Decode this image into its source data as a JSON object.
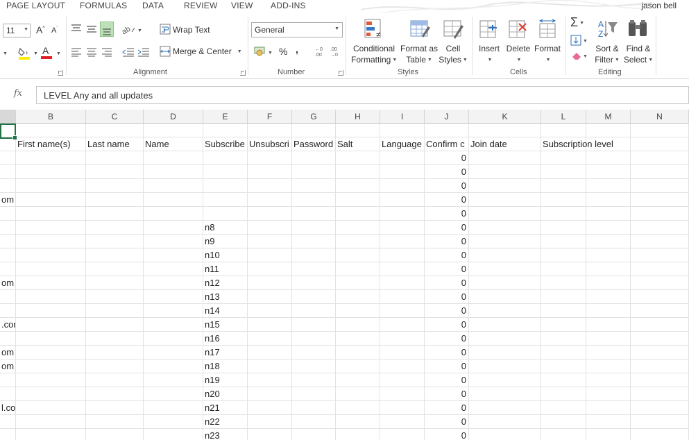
{
  "tabs": [
    "PAGE LAYOUT",
    "FORMULAS",
    "DATA",
    "REVIEW",
    "VIEW",
    "ADD-INS"
  ],
  "user": "jason bell",
  "ribbon": {
    "font_size": "11",
    "wrap_text": "Wrap Text",
    "merge_center": "Merge & Center",
    "number_format": "General",
    "percent": "%",
    "comma": ",",
    "conditional_formatting": [
      "Conditional",
      "Formatting"
    ],
    "format_as_table": [
      "Format as",
      "Table"
    ],
    "cell_styles": [
      "Cell",
      "Styles"
    ],
    "insert": "Insert",
    "delete": "Delete",
    "format": "Format",
    "sort_filter": [
      "Sort &",
      "Filter"
    ],
    "find_select": [
      "Find &",
      "Select"
    ],
    "groups": {
      "alignment": "Alignment",
      "number": "Number",
      "styles": "Styles",
      "cells": "Cells",
      "editing": "Editing"
    }
  },
  "formula_bar": {
    "fx": "fx",
    "content": "LEVEL Any and all updates"
  },
  "columns": [
    "B",
    "C",
    "D",
    "E",
    "F",
    "G",
    "H",
    "I",
    "J",
    "K",
    "L",
    "M",
    "N"
  ],
  "header_row": [
    "First name(s)",
    "Last name",
    "Name",
    "Subscribe",
    "Unsubscri",
    "Password",
    "Salt",
    "Language",
    "Confirm c",
    "Join date",
    "Subscription level"
  ],
  "rows": [
    {
      "a": "",
      "e": "",
      "j": "0"
    },
    {
      "a": "",
      "e": "",
      "j": "0"
    },
    {
      "a": "",
      "e": "",
      "j": "0"
    },
    {
      "a": "om",
      "e": "",
      "j": "0"
    },
    {
      "a": "",
      "e": "",
      "j": "0"
    },
    {
      "a": "",
      "e": "n8",
      "j": "0"
    },
    {
      "a": "",
      "e": "n9",
      "j": "0"
    },
    {
      "a": "",
      "e": "n10",
      "j": "0"
    },
    {
      "a": "",
      "e": "n11",
      "j": "0"
    },
    {
      "a": "om",
      "e": "n12",
      "j": "0"
    },
    {
      "a": "",
      "e": "n13",
      "j": "0"
    },
    {
      "a": "",
      "e": "n14",
      "j": "0"
    },
    {
      "a": ".com",
      "e": "n15",
      "j": "0"
    },
    {
      "a": "",
      "e": "n16",
      "j": "0"
    },
    {
      "a": "om",
      "e": "n17",
      "j": "0"
    },
    {
      "a": "om",
      "e": "n18",
      "j": "0"
    },
    {
      "a": "",
      "e": "n19",
      "j": "0"
    },
    {
      "a": "",
      "e": "n20",
      "j": "0"
    },
    {
      "a": "l.com",
      "e": "n21",
      "j": "0"
    },
    {
      "a": "",
      "e": "n22",
      "j": "0"
    },
    {
      "a": "",
      "e": "n23",
      "j": "0"
    }
  ],
  "colors": {
    "accent": "#217346",
    "font_color_bar": "#e02020",
    "fill_color_bar": "#ffee00"
  }
}
